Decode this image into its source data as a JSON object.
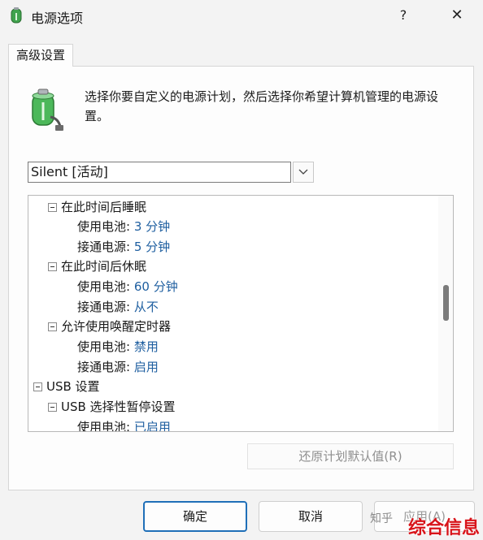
{
  "window": {
    "title": "电源选项",
    "help_label": "?",
    "close_label": "✕"
  },
  "tabs": [
    {
      "label": "高级设置"
    }
  ],
  "description": "选择你要自定义的电源计划，然后选择你希望计算机管理的电源设置。",
  "plan_dropdown": {
    "selected": "Silent [活动]"
  },
  "tree": {
    "items": [
      {
        "label": "在此时间后睡眠",
        "level": 1,
        "expanded": true
      },
      {
        "label": "使用电池:",
        "value": "3 分钟",
        "level": 2
      },
      {
        "label": "接通电源:",
        "value": "5 分钟",
        "level": 2
      },
      {
        "label": "在此时间后休眠",
        "level": 1,
        "expanded": true
      },
      {
        "label": "使用电池:",
        "value": "60 分钟",
        "level": 2
      },
      {
        "label": "接通电源:",
        "value": "从不",
        "level": 2
      },
      {
        "label": "允许使用唤醒定时器",
        "level": 1,
        "expanded": true
      },
      {
        "label": "使用电池:",
        "value": "禁用",
        "level": 2
      },
      {
        "label": "接通电源:",
        "value": "启用",
        "level": 2
      },
      {
        "label": "USB 设置",
        "level": 0,
        "expanded": true
      },
      {
        "label": "USB 选择性暂停设置",
        "level": 1,
        "expanded": true
      },
      {
        "label": "使用电池:",
        "value": "已启用",
        "level": 2
      }
    ]
  },
  "buttons": {
    "restore": "还原计划默认值(R)",
    "ok": "确定",
    "cancel": "取消",
    "apply": "应用(A)"
  },
  "watermarks": {
    "zhihu": "知乎",
    "site": "综合信息"
  },
  "colors": {
    "value_text": "#1f5fa0",
    "ok_border": "#1f6fb8",
    "watermark": "#d8141a"
  }
}
